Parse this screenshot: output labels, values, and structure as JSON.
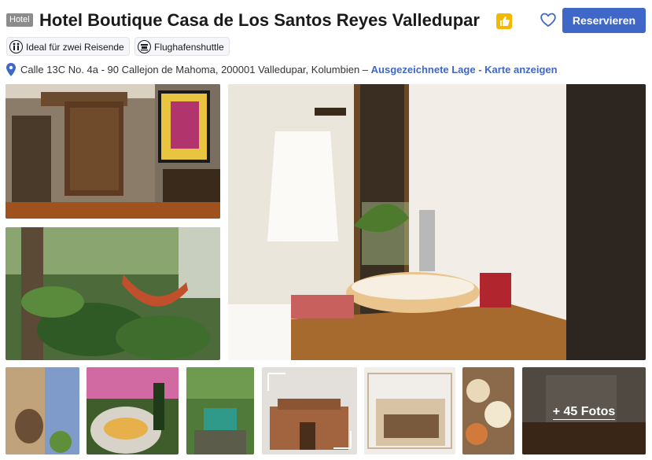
{
  "header": {
    "badge": "Hotel",
    "title": "Hotel Boutique Casa de Los Santos Reyes Valledupar",
    "reserve_label": "Reservieren"
  },
  "chips": [
    {
      "label": "Ideal für zwei Reisende",
      "icon": "couple-icon"
    },
    {
      "label": "Flughafenshuttle",
      "icon": "shuttle-icon"
    }
  ],
  "address": {
    "text": "Calle 13C No. 4a - 90 Callejon de Mahoma, 200001 Valledupar, Kolumbien – ",
    "link": "Ausgezeichnete Lage - Karte anzeigen"
  },
  "gallery": {
    "more_label": "+ 45 Fotos"
  },
  "colors": {
    "accent": "#3f67c7",
    "badge_yellow": "#f5b800"
  }
}
